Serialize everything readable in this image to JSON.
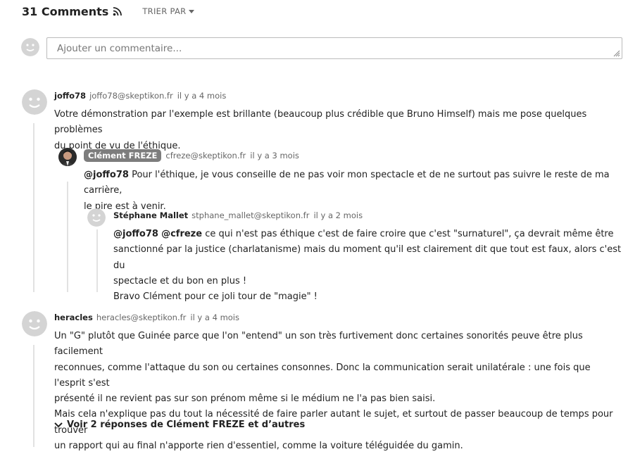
{
  "header": {
    "count": "31 Comments",
    "sort": "TRIER PAR"
  },
  "composer": {
    "placeholder": "Ajouter un commentaire..."
  },
  "comments": [
    {
      "author": "joffo78",
      "email": "joffo78@skeptikon.fr",
      "time": "il y a 4 mois",
      "lines": [
        "Votre démonstration par l'exemple est brillante (beaucoup plus crédible que Bruno Himself) mais me pose quelques problèmes",
        "du point de vu de l'éthique."
      ]
    },
    {
      "author": "Clément FREZE",
      "email": "cfreze@skeptikon.fr",
      "time": "il y a 3 mois",
      "mention": "@joffo78",
      "lines": [
        " Pour l'éthique, je vous conseille de ne pas voir mon spectacle et de ne surtout pas suivre le reste de ma carrière,",
        "le pire est à venir."
      ]
    },
    {
      "author": "Stéphane Mallet",
      "email": "stphane_mallet@skeptikon.fr",
      "time": "il y a 2 mois",
      "mention1": "@joffo78",
      "mention2": "@cfreze",
      "lines": [
        " ce qui n'est pas éthique c'est de faire croire que c'est \"surnaturel\", ça devrait même être",
        "sanctionné par la justice (charlatanisme) mais du moment qu'il est clairement dit que tout est faux, alors c'est du",
        "spectacle et du bon en plus !",
        "Bravo Clément pour ce joli tour de \"magie\" !"
      ]
    },
    {
      "author": "heracles",
      "email": "heracles@skeptikon.fr",
      "time": "il y a 4 mois",
      "lines": [
        "Un \"G\" plutôt que Guinée parce que l'on \"entend\" un son très furtivement donc certaines sonorités peuve être plus facilement",
        "reconnues, comme l'attaque du son ou certaines consonnes. Donc la communication serait unilatérale : une fois que l'esprit s'est",
        "présenté il ne revient pas sur son prénom même si le médium ne l'a pas bien saisi.",
        "Mais cela n'explique pas du tout la nécessité de faire parler autant le sujet, et surtout de passer beaucoup de temps pour trouver",
        "un rapport qui au final n'apporte rien d'essentiel, comme la voiture téléguidée du gamin."
      ],
      "replies_label": "Voir 2 réponses de Clément FREZE et d’autres"
    }
  ],
  "icons": {
    "rss": "rss-icon",
    "caret": "caret-down-icon",
    "avatar": "default-avatar-icon",
    "chevron": "chevron-down-icon"
  }
}
